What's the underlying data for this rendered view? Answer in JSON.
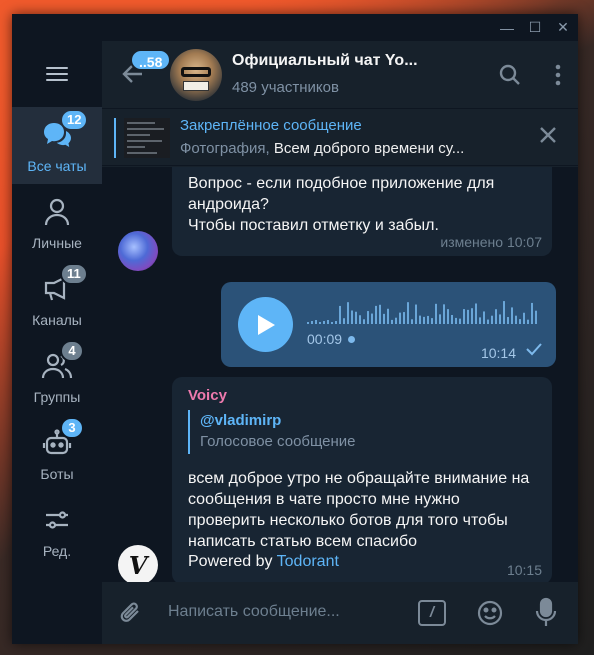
{
  "window": {
    "min_glyph": "—",
    "max_glyph": "☐",
    "close_glyph": "✕"
  },
  "colors": {
    "accent": "#5eb5f7",
    "sidebar": "#0e1621",
    "panel": "#17212b",
    "incoming_bubble": "#182533",
    "outgoing_bubble": "#2b5278",
    "sender_name": "#ee7aae"
  },
  "sidebar": {
    "items": [
      {
        "label": "Все чаты",
        "badge": "12",
        "icon": "chats-icon",
        "active": true
      },
      {
        "label": "Личные",
        "badge": "",
        "icon": "person-icon"
      },
      {
        "label": "Каналы",
        "badge": "11",
        "icon": "channel-icon"
      },
      {
        "label": "Группы",
        "badge": "4",
        "icon": "group-icon"
      },
      {
        "label": "Боты",
        "badge": "3",
        "icon": "bot-icon"
      },
      {
        "label": "Ред.",
        "badge": "",
        "icon": "edit-folders-icon"
      }
    ]
  },
  "header": {
    "back_badge": "..58",
    "title": "Официальный чат Yo...",
    "subtitle": "489 участников"
  },
  "pinned": {
    "title": "Закреплённое сообщение",
    "prefix": "Фотография,",
    "text": "Всем доброго времени су..."
  },
  "messages": [
    {
      "text_lines": [
        "Вопрос - если подобное приложение для",
        "андроида?",
        "Чтобы поставил отметку и забыл."
      ],
      "meta": "изменено 10:07"
    },
    {
      "type": "voice",
      "duration": "00:09",
      "time": "10:14"
    },
    {
      "sender": "Voicy",
      "reply_author": "@vladimirp",
      "reply_text": "Голосовое сообщение",
      "text": "всем доброе утро не обращайте внимание на сообщения в чате просто мне нужно проверить несколько ботов для того чтобы написать статью всем спасибо",
      "powered_prefix": "Powered by",
      "powered_link": "Todorant",
      "time": "10:15",
      "avatar_letter": "V"
    }
  ],
  "compose": {
    "placeholder": "Написать сообщение...",
    "cmd_glyph": "/"
  }
}
